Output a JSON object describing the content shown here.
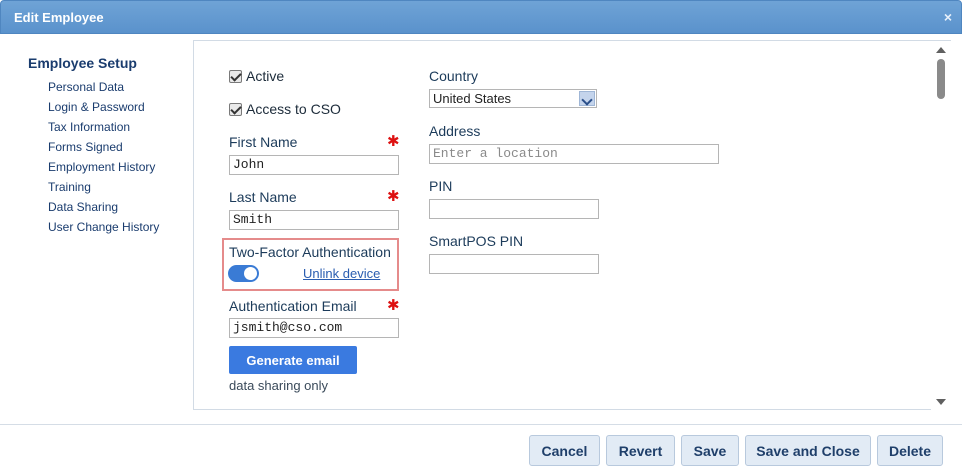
{
  "dialog": {
    "title": "Edit Employee",
    "close_glyph": "×"
  },
  "sidebar": {
    "heading": "Employee Setup",
    "items": [
      {
        "label": "Personal Data"
      },
      {
        "label": "Login & Password"
      },
      {
        "label": "Tax Information"
      },
      {
        "label": "Forms Signed"
      },
      {
        "label": "Employment History"
      },
      {
        "label": "Training"
      },
      {
        "label": "Data Sharing"
      },
      {
        "label": "User Change History"
      }
    ]
  },
  "form": {
    "active_label": "Active",
    "active_checked": true,
    "access_label": "Access to CSO",
    "access_checked": true,
    "first_name_label": "First Name",
    "first_name_value": "John",
    "last_name_label": "Last Name",
    "last_name_value": "Smith",
    "required_glyph": "✱",
    "tfa_label": "Two-Factor Authentication",
    "tfa_enabled": true,
    "unlink_label": "Unlink device",
    "auth_email_label": "Authentication Email",
    "auth_email_value": "jsmith@cso.com",
    "generate_email_label": "Generate email",
    "note_text": "data sharing only",
    "country_label": "Country",
    "country_value": "United States",
    "address_label": "Address",
    "address_placeholder": "Enter a location",
    "pin_label": "PIN",
    "pin_value": "",
    "smartpos_pin_label": "SmartPOS PIN",
    "smartpos_pin_value": ""
  },
  "footer": {
    "cancel_label": "Cancel",
    "revert_label": "Revert",
    "save_label": "Save",
    "save_close_label": "Save and Close",
    "delete_label": "Delete"
  },
  "colors": {
    "title_bar": "#5a92cc",
    "primary_button": "#3a7ae0",
    "toggle_on": "#3a7bd5",
    "required": "#dd1111",
    "highlight_border": "#e58b8b"
  }
}
